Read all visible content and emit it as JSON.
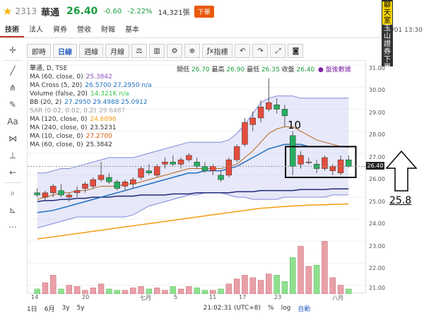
{
  "header": {
    "code": "2313",
    "name": "華通",
    "price": "26.40",
    "change": "-0.60",
    "change_pct": "-2.22%",
    "volume": "14,321張",
    "badge": "下單"
  },
  "tabs": [
    {
      "label": "技術",
      "active": true
    },
    {
      "label": "法人",
      "active": false
    },
    {
      "label": "資券",
      "active": false
    },
    {
      "label": "營收",
      "active": false
    },
    {
      "label": "財報",
      "active": false
    },
    {
      "label": "基本",
      "active": false
    }
  ],
  "timestamp": "08/01 13:30",
  "banner": {
    "top": "聊天室",
    "bottom": "玉山證券下單"
  },
  "toolbar": {
    "intraday": "即時",
    "daily": "日線",
    "weekly": "週線",
    "monthly": "月線",
    "indicators": "指標"
  },
  "legend": {
    "symbol": "華通, D, TSE",
    "ohlc_labels": {
      "open": "開低",
      "high": "最高",
      "low": "最低",
      "close": "收盤"
    },
    "ohlc_values": {
      "open": "26.70",
      "high": "26.90",
      "low": "26.35",
      "close": "26.40"
    },
    "broadcast": "● 盤後數據",
    "rows": [
      {
        "label": "MA (60, close, 0)",
        "value": "25.3842",
        "color": "#8c54b8"
      },
      {
        "label": "MA Cross (5, 20)",
        "value": "26.5700 27.2950 n/a",
        "color": "#1f6fbf"
      },
      {
        "label": "Volume (false, 20)",
        "value": "14.321K n/a",
        "color": "#35c34a"
      },
      {
        "label": "BB (20, 2)",
        "value": "27.2950 29.4988 25.0912",
        "color": "#1f6fbf"
      },
      {
        "label": "SAR (0.02, 0.02, 0.2)",
        "value": "29.6487",
        "color": "#aaaaaa"
      },
      {
        "label": "MA (120, close, 0)",
        "value": "24.6896",
        "color": "#f39c12"
      },
      {
        "label": "MA (240, close, 0)",
        "value": "23.5231",
        "color": "#333333"
      },
      {
        "label": "MA (10, close, 0)",
        "value": "27.2700",
        "color": "#d35400"
      },
      {
        "label": "MA (60, close, 0)",
        "value": "25.3842",
        "color": "#333333"
      }
    ]
  },
  "yaxis": [
    "31.00",
    "30.00",
    "29.00",
    "28.00",
    "27.00",
    "26.00",
    "25.00",
    "24.00",
    "23.00",
    "22.00",
    "21.00"
  ],
  "price_tag": "26.40",
  "xaxis": [
    "14",
    "20",
    "七月",
    "5",
    "11",
    "17",
    "23",
    "八月"
  ],
  "bottom": {
    "ranges": [
      "1日",
      "6月",
      "3y",
      "5y"
    ],
    "time": "21:02:31 (UTC+8)",
    "pct": "%",
    "log": "log",
    "auto": "自動"
  },
  "annotations": {
    "box_label": "10",
    "target": "25.8"
  },
  "chart_data": {
    "type": "candlestick",
    "ylim": [
      20.6,
      31.2
    ],
    "candles": [
      {
        "o": 25.2,
        "h": 25.4,
        "l": 25.0,
        "c": 25.1
      },
      {
        "o": 25.0,
        "h": 25.3,
        "l": 24.8,
        "c": 25.2
      },
      {
        "o": 25.2,
        "h": 25.6,
        "l": 25.0,
        "c": 25.5
      },
      {
        "o": 25.3,
        "h": 25.6,
        "l": 25.0,
        "c": 25.1
      },
      {
        "o": 25.0,
        "h": 25.2,
        "l": 24.8,
        "c": 25.1
      },
      {
        "o": 25.2,
        "h": 25.5,
        "l": 25.0,
        "c": 25.3
      },
      {
        "o": 25.4,
        "h": 25.7,
        "l": 25.2,
        "c": 25.6
      },
      {
        "o": 25.5,
        "h": 25.9,
        "l": 25.4,
        "c": 25.8
      },
      {
        "o": 25.8,
        "h": 26.6,
        "l": 25.7,
        "c": 26.0
      },
      {
        "o": 25.9,
        "h": 26.1,
        "l": 25.6,
        "c": 25.7
      },
      {
        "o": 25.7,
        "h": 25.8,
        "l": 25.3,
        "c": 25.4
      },
      {
        "o": 25.5,
        "h": 25.8,
        "l": 25.3,
        "c": 25.7
      },
      {
        "o": 25.6,
        "h": 25.9,
        "l": 25.4,
        "c": 25.8
      },
      {
        "o": 25.9,
        "h": 26.4,
        "l": 25.8,
        "c": 26.3
      },
      {
        "o": 26.2,
        "h": 26.5,
        "l": 26.0,
        "c": 26.1
      },
      {
        "o": 26.0,
        "h": 26.5,
        "l": 25.9,
        "c": 26.4
      },
      {
        "o": 26.5,
        "h": 26.8,
        "l": 26.3,
        "c": 26.6
      },
      {
        "o": 26.6,
        "h": 26.9,
        "l": 26.4,
        "c": 26.5
      },
      {
        "o": 26.5,
        "h": 26.8,
        "l": 26.3,
        "c": 26.7
      },
      {
        "o": 26.7,
        "h": 27.0,
        "l": 26.6,
        "c": 26.9
      },
      {
        "o": 26.6,
        "h": 26.8,
        "l": 26.3,
        "c": 26.4
      },
      {
        "o": 26.4,
        "h": 26.6,
        "l": 26.1,
        "c": 26.2
      },
      {
        "o": 26.2,
        "h": 26.5,
        "l": 26.0,
        "c": 26.4
      },
      {
        "o": 26.0,
        "h": 26.2,
        "l": 25.7,
        "c": 25.8
      },
      {
        "o": 26.0,
        "h": 26.8,
        "l": 25.9,
        "c": 26.7
      },
      {
        "o": 26.7,
        "h": 27.4,
        "l": 26.6,
        "c": 27.3
      },
      {
        "o": 27.4,
        "h": 28.6,
        "l": 27.3,
        "c": 28.4
      },
      {
        "o": 28.3,
        "h": 28.9,
        "l": 28.0,
        "c": 28.6
      },
      {
        "o": 28.6,
        "h": 29.4,
        "l": 28.4,
        "c": 29.1
      },
      {
        "o": 29.0,
        "h": 30.4,
        "l": 28.9,
        "c": 29.3
      },
      {
        "o": 29.2,
        "h": 29.5,
        "l": 28.8,
        "c": 29.0
      },
      {
        "o": 29.0,
        "h": 29.2,
        "l": 28.2,
        "c": 28.7
      },
      {
        "o": 27.8,
        "h": 28.0,
        "l": 26.0,
        "c": 26.4
      },
      {
        "o": 26.5,
        "h": 27.1,
        "l": 26.3,
        "c": 26.9
      },
      {
        "o": 26.6,
        "h": 26.8,
        "l": 26.5,
        "c": 26.6
      },
      {
        "o": 26.5,
        "h": 26.7,
        "l": 26.1,
        "c": 26.3
      },
      {
        "o": 26.3,
        "h": 26.9,
        "l": 26.2,
        "c": 26.8
      },
      {
        "o": 26.2,
        "h": 26.5,
        "l": 26.0,
        "c": 26.4
      },
      {
        "o": 26.1,
        "h": 26.9,
        "l": 26.0,
        "c": 26.7
      },
      {
        "o": 26.7,
        "h": 26.9,
        "l": 26.35,
        "c": 26.4
      }
    ],
    "volumes": [
      0.4,
      0.9,
      1.5,
      0.4,
      0.7,
      0.6,
      0.3,
      0.5,
      0.8,
      0.4,
      0.3,
      0.3,
      0.5,
      0.6,
      0.4,
      0.5,
      0.3,
      0.6,
      0.4,
      0.6,
      0.5,
      0.3,
      0.3,
      0.4,
      0.8,
      1.2,
      1.5,
      1.3,
      1.1,
      1.6,
      1.5,
      1.0,
      2.9,
      3.8,
      2.2,
      2.3,
      4.2,
      1.3,
      0.7,
      0.4
    ],
    "bb_upper": [
      26.1,
      26.1,
      26.2,
      26.3,
      26.3,
      26.4,
      26.5,
      26.6,
      26.7,
      26.8,
      26.8,
      26.8,
      26.8,
      26.9,
      27.0,
      27.1,
      27.2,
      27.3,
      27.4,
      27.5,
      27.5,
      27.5,
      27.5,
      27.5,
      27.6,
      27.9,
      28.3,
      28.8,
      29.3,
      29.5,
      29.6,
      29.6,
      29.6,
      29.5,
      29.5,
      29.5,
      29.5,
      29.5,
      29.5,
      29.5
    ],
    "bb_lower": [
      23.6,
      23.7,
      23.8,
      23.9,
      24.0,
      24.1,
      24.1,
      24.1,
      24.1,
      24.1,
      24.1,
      24.1,
      24.2,
      24.4,
      24.6,
      24.7,
      24.8,
      24.9,
      25.0,
      25.1,
      25.1,
      25.2,
      25.2,
      25.2,
      25.1,
      25.0,
      25.0,
      24.9,
      24.9,
      24.9,
      24.9,
      25.0,
      25.0,
      25.0,
      25.0,
      25.0,
      25.0,
      25.1,
      25.1,
      25.1
    ],
    "ma10": [
      24.9,
      25.0,
      25.1,
      25.2,
      25.2,
      25.3,
      25.3,
      25.4,
      25.5,
      25.5,
      25.5,
      25.6,
      25.6,
      25.7,
      25.8,
      25.9,
      26.0,
      26.1,
      26.2,
      26.3,
      26.3,
      26.3,
      26.3,
      26.3,
      26.4,
      26.5,
      26.8,
      27.1,
      27.5,
      27.9,
      28.1,
      28.2,
      28.2,
      28.0,
      27.8,
      27.6,
      27.5,
      27.4,
      27.3,
      27.27
    ],
    "ma20": [
      24.3,
      24.35,
      24.4,
      24.5,
      24.6,
      24.7,
      24.8,
      24.9,
      25.0,
      25.1,
      25.2,
      25.3,
      25.4,
      25.5,
      25.6,
      25.7,
      25.8,
      25.9,
      26.0,
      26.1,
      26.1,
      26.2,
      26.2,
      26.2,
      26.3,
      26.4,
      26.6,
      26.8,
      27.0,
      27.2,
      27.3,
      27.4,
      27.4,
      27.4,
      27.3,
      27.3,
      27.3,
      27.3,
      27.3,
      27.3
    ],
    "ma60": [
      24.8,
      24.85,
      24.85,
      24.9,
      24.9,
      24.95,
      24.95,
      25.0,
      25.0,
      25.0,
      25.05,
      25.05,
      25.05,
      25.1,
      25.1,
      25.1,
      25.1,
      25.15,
      25.15,
      25.15,
      25.2,
      25.2,
      25.2,
      25.2,
      25.2,
      25.25,
      25.25,
      25.25,
      25.3,
      25.3,
      25.3,
      25.3,
      25.3,
      25.35,
      25.35,
      25.35,
      25.35,
      25.38,
      25.38,
      25.38
    ],
    "ma120": [
      23.1,
      23.15,
      23.2,
      23.25,
      23.3,
      23.35,
      23.4,
      23.45,
      23.5,
      23.55,
      23.6,
      23.65,
      23.7,
      23.75,
      23.8,
      23.85,
      23.9,
      23.95,
      24.0,
      24.05,
      24.1,
      24.15,
      24.2,
      24.25,
      24.3,
      24.35,
      24.4,
      24.45,
      24.5,
      24.52,
      24.55,
      24.58,
      24.6,
      24.62,
      24.64,
      24.65,
      24.66,
      24.67,
      24.68,
      24.69
    ]
  }
}
